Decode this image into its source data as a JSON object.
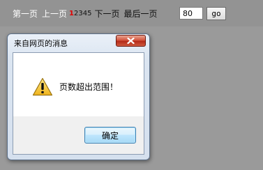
{
  "pager": {
    "first": "第一页",
    "prev": "上一页",
    "pages": [
      {
        "label": "1",
        "current": true
      },
      {
        "label": "2",
        "current": false
      },
      {
        "label": "3",
        "current": false
      },
      {
        "label": "4",
        "current": false
      },
      {
        "label": "5",
        "current": false
      }
    ],
    "next": "下一页",
    "last": "最后一页",
    "page_input_value": "80",
    "go_label": "go"
  },
  "dialog": {
    "title": "来自网页的消息",
    "message": "页数超出范围！",
    "ok_label": "确定",
    "icon": "warning-icon"
  },
  "colors": {
    "background": "#9a9a9a",
    "current_page": "#e00000",
    "ok_border": "#3c7fb1",
    "close_button": "#c83f2a"
  }
}
